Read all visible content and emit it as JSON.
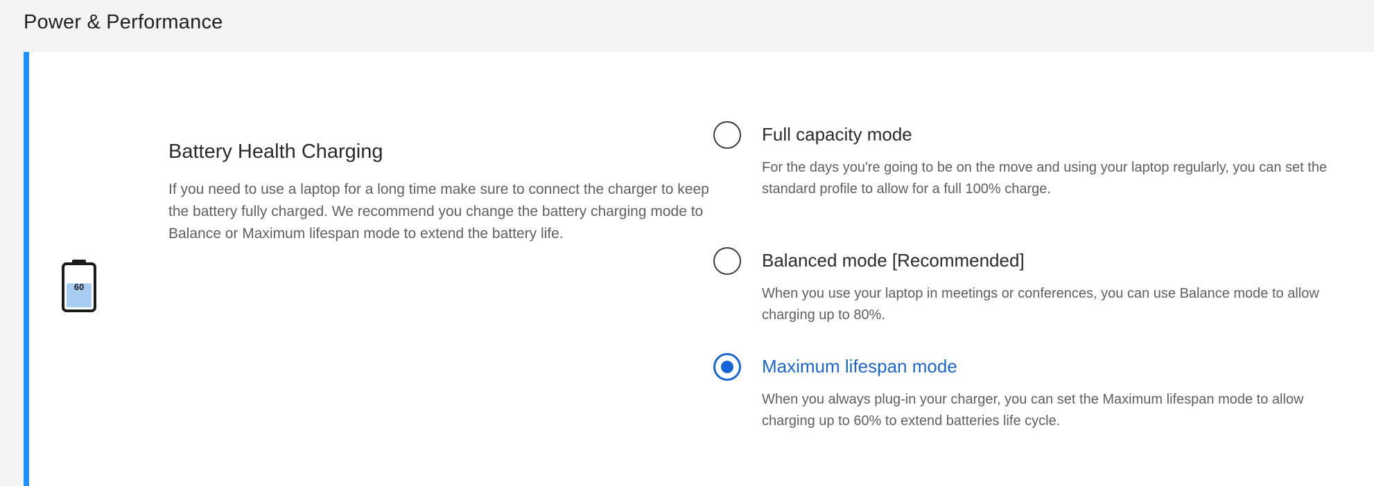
{
  "header": {
    "title": "Power & Performance"
  },
  "battery": {
    "level_text": "60",
    "icon": "battery-icon",
    "level_percent": 60
  },
  "section": {
    "title": "Battery Health Charging",
    "description": "If you need to use a laptop for a long time make sure to connect the charger to keep the battery fully charged. We recommend you change the battery charging mode to Balance or Maximum lifespan mode to extend the battery life."
  },
  "options": [
    {
      "label": "Full capacity mode",
      "description": "For the days you're going to be on the move and using your laptop regularly, you can set the standard profile to allow for a full 100% charge.",
      "selected": false
    },
    {
      "label": "Balanced mode [Recommended]",
      "description": "When you use your laptop in meetings or conferences, you can use Balance mode to allow charging up to 80%.",
      "selected": false
    },
    {
      "label": "Maximum lifespan mode",
      "description": "When you always plug-in your charger, you can set the Maximum lifespan mode to allow charging up to 60% to extend batteries life cycle.",
      "selected": true
    }
  ],
  "colors": {
    "accent": "#1e90ff",
    "selected": "#1565d8",
    "battery_fill": "#a8cdf2"
  }
}
